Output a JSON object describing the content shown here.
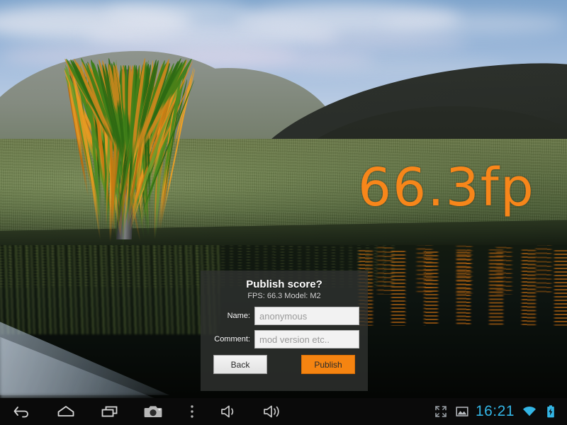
{
  "scene": {
    "name": "3d-benchmark-scene",
    "description": "3D rendered outdoor scene with willow tree, hills, grass and reflective water",
    "fps_overlay_text": "66.3fp",
    "fps_overlay_color": "#f7861a",
    "sky_color": "#a8c0de",
    "grass_color": "#5f7043",
    "water_color": "#0d1410",
    "hill_color": "#23271f"
  },
  "dialog": {
    "title": "Publish score?",
    "subtitle": "FPS:  66.3 Model: M2",
    "background_color": "#303230",
    "fields": [
      {
        "label": "Name:",
        "value": "",
        "placeholder": "anonymous",
        "name": "name-field"
      },
      {
        "label": "Comment:",
        "value": "",
        "placeholder": "mod version etc..",
        "name": "comment-field"
      }
    ],
    "buttons": {
      "back": {
        "label": "Back",
        "color": "#e2e2e2"
      },
      "publish": {
        "label": "Publish",
        "color": "#f58411"
      }
    }
  },
  "navbar": {
    "background_color": "#0a0a0a",
    "left_items": [
      {
        "icon": "back-icon",
        "label": "Back"
      },
      {
        "icon": "home-icon",
        "label": "Home"
      },
      {
        "icon": "recents-icon",
        "label": "Recent apps"
      },
      {
        "icon": "camera-icon",
        "label": "Screenshot"
      },
      {
        "icon": "overflow-menu-icon",
        "label": "Menu"
      },
      {
        "icon": "volume-down-icon",
        "label": "Volume down"
      },
      {
        "icon": "volume-up-icon",
        "label": "Volume up"
      }
    ],
    "status_items": [
      {
        "icon": "fullscreen-icon",
        "label": "Fullscreen"
      },
      {
        "icon": "screenshot-image-icon",
        "label": "Screenshot saved"
      }
    ],
    "clock": "16:21",
    "clock_color": "#33b5e5",
    "right_items": [
      {
        "icon": "wifi-icon",
        "label": "Wi-Fi connected"
      },
      {
        "icon": "battery-charging-icon",
        "label": "Battery charging"
      }
    ]
  }
}
